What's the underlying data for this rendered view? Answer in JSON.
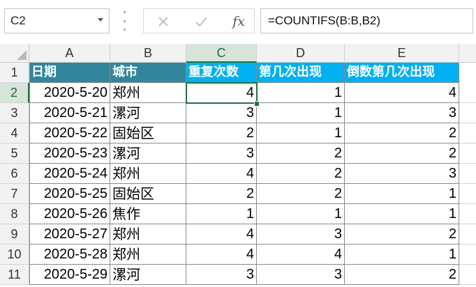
{
  "name_box": {
    "value": "C2"
  },
  "formula_bar": {
    "fx_label": "fx",
    "formula": "=COUNTIFS(B:B,B2)"
  },
  "columns": [
    "A",
    "B",
    "C",
    "D",
    "E"
  ],
  "selected_column": "C",
  "selected_row": "2",
  "headers": [
    "日期",
    "城市",
    "重复次数",
    "第几次出现",
    "倒数第几次出现"
  ],
  "header_colors": {
    "teal": "#31869b",
    "cyan": "#00b0f0"
  },
  "rows": [
    {
      "num": "1"
    },
    {
      "num": "2",
      "date": "2020-5-20",
      "city": "郑州",
      "c": "4",
      "d": "1",
      "e": "4"
    },
    {
      "num": "3",
      "date": "2020-5-21",
      "city": "漯河",
      "c": "3",
      "d": "1",
      "e": "3"
    },
    {
      "num": "4",
      "date": "2020-5-22",
      "city": "固始区",
      "c": "2",
      "d": "1",
      "e": "2"
    },
    {
      "num": "5",
      "date": "2020-5-23",
      "city": "漯河",
      "c": "3",
      "d": "2",
      "e": "2"
    },
    {
      "num": "6",
      "date": "2020-5-24",
      "city": "郑州",
      "c": "4",
      "d": "2",
      "e": "3"
    },
    {
      "num": "7",
      "date": "2020-5-25",
      "city": "固始区",
      "c": "2",
      "d": "2",
      "e": "1"
    },
    {
      "num": "8",
      "date": "2020-5-26",
      "city": "焦作",
      "c": "1",
      "d": "1",
      "e": "1"
    },
    {
      "num": "9",
      "date": "2020-5-27",
      "city": "郑州",
      "c": "4",
      "d": "3",
      "e": "2"
    },
    {
      "num": "10",
      "date": "2020-5-28",
      "city": "郑州",
      "c": "4",
      "d": "4",
      "e": "1"
    },
    {
      "num": "11",
      "date": "2020-5-29",
      "city": "漯河",
      "c": "3",
      "d": "3",
      "e": "2"
    }
  ]
}
